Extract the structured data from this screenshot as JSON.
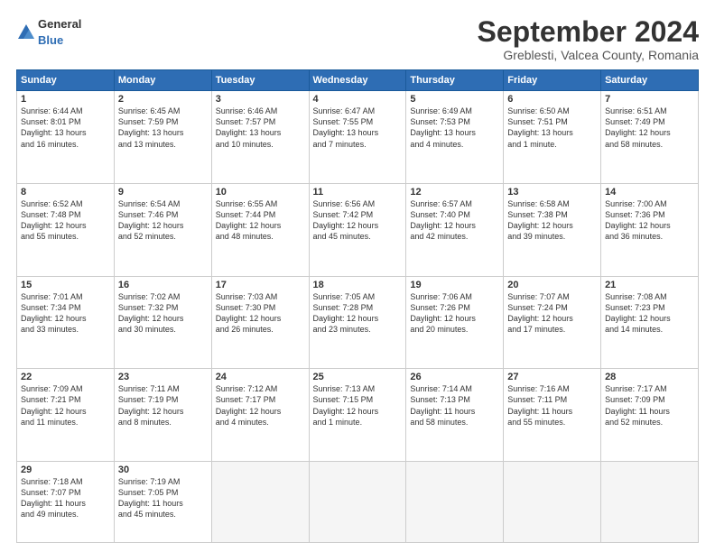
{
  "header": {
    "logo_general": "General",
    "logo_blue": "Blue",
    "month_title": "September 2024",
    "subtitle": "Greblesti, Valcea County, Romania"
  },
  "calendar": {
    "days_of_week": [
      "Sunday",
      "Monday",
      "Tuesday",
      "Wednesday",
      "Thursday",
      "Friday",
      "Saturday"
    ],
    "weeks": [
      [
        null,
        null,
        null,
        null,
        null,
        null,
        null
      ]
    ]
  },
  "days": [
    {
      "num": "1",
      "col": 0,
      "info": "Sunrise: 6:44 AM\nSunset: 8:01 PM\nDaylight: 13 hours\nand 16 minutes."
    },
    {
      "num": "2",
      "col": 1,
      "info": "Sunrise: 6:45 AM\nSunset: 7:59 PM\nDaylight: 13 hours\nand 13 minutes."
    },
    {
      "num": "3",
      "col": 2,
      "info": "Sunrise: 6:46 AM\nSunset: 7:57 PM\nDaylight: 13 hours\nand 10 minutes."
    },
    {
      "num": "4",
      "col": 3,
      "info": "Sunrise: 6:47 AM\nSunset: 7:55 PM\nDaylight: 13 hours\nand 7 minutes."
    },
    {
      "num": "5",
      "col": 4,
      "info": "Sunrise: 6:49 AM\nSunset: 7:53 PM\nDaylight: 13 hours\nand 4 minutes."
    },
    {
      "num": "6",
      "col": 5,
      "info": "Sunrise: 6:50 AM\nSunset: 7:51 PM\nDaylight: 13 hours\nand 1 minute."
    },
    {
      "num": "7",
      "col": 6,
      "info": "Sunrise: 6:51 AM\nSunset: 7:49 PM\nDaylight: 12 hours\nand 58 minutes."
    },
    {
      "num": "8",
      "col": 0,
      "info": "Sunrise: 6:52 AM\nSunset: 7:48 PM\nDaylight: 12 hours\nand 55 minutes."
    },
    {
      "num": "9",
      "col": 1,
      "info": "Sunrise: 6:54 AM\nSunset: 7:46 PM\nDaylight: 12 hours\nand 52 minutes."
    },
    {
      "num": "10",
      "col": 2,
      "info": "Sunrise: 6:55 AM\nSunset: 7:44 PM\nDaylight: 12 hours\nand 48 minutes."
    },
    {
      "num": "11",
      "col": 3,
      "info": "Sunrise: 6:56 AM\nSunset: 7:42 PM\nDaylight: 12 hours\nand 45 minutes."
    },
    {
      "num": "12",
      "col": 4,
      "info": "Sunrise: 6:57 AM\nSunset: 7:40 PM\nDaylight: 12 hours\nand 42 minutes."
    },
    {
      "num": "13",
      "col": 5,
      "info": "Sunrise: 6:58 AM\nSunset: 7:38 PM\nDaylight: 12 hours\nand 39 minutes."
    },
    {
      "num": "14",
      "col": 6,
      "info": "Sunrise: 7:00 AM\nSunset: 7:36 PM\nDaylight: 12 hours\nand 36 minutes."
    },
    {
      "num": "15",
      "col": 0,
      "info": "Sunrise: 7:01 AM\nSunset: 7:34 PM\nDaylight: 12 hours\nand 33 minutes."
    },
    {
      "num": "16",
      "col": 1,
      "info": "Sunrise: 7:02 AM\nSunset: 7:32 PM\nDaylight: 12 hours\nand 30 minutes."
    },
    {
      "num": "17",
      "col": 2,
      "info": "Sunrise: 7:03 AM\nSunset: 7:30 PM\nDaylight: 12 hours\nand 26 minutes."
    },
    {
      "num": "18",
      "col": 3,
      "info": "Sunrise: 7:05 AM\nSunset: 7:28 PM\nDaylight: 12 hours\nand 23 minutes."
    },
    {
      "num": "19",
      "col": 4,
      "info": "Sunrise: 7:06 AM\nSunset: 7:26 PM\nDaylight: 12 hours\nand 20 minutes."
    },
    {
      "num": "20",
      "col": 5,
      "info": "Sunrise: 7:07 AM\nSunset: 7:24 PM\nDaylight: 12 hours\nand 17 minutes."
    },
    {
      "num": "21",
      "col": 6,
      "info": "Sunrise: 7:08 AM\nSunset: 7:23 PM\nDaylight: 12 hours\nand 14 minutes."
    },
    {
      "num": "22",
      "col": 0,
      "info": "Sunrise: 7:09 AM\nSunset: 7:21 PM\nDaylight: 12 hours\nand 11 minutes."
    },
    {
      "num": "23",
      "col": 1,
      "info": "Sunrise: 7:11 AM\nSunset: 7:19 PM\nDaylight: 12 hours\nand 8 minutes."
    },
    {
      "num": "24",
      "col": 2,
      "info": "Sunrise: 7:12 AM\nSunset: 7:17 PM\nDaylight: 12 hours\nand 4 minutes."
    },
    {
      "num": "25",
      "col": 3,
      "info": "Sunrise: 7:13 AM\nSunset: 7:15 PM\nDaylight: 12 hours\nand 1 minute."
    },
    {
      "num": "26",
      "col": 4,
      "info": "Sunrise: 7:14 AM\nSunset: 7:13 PM\nDaylight: 11 hours\nand 58 minutes."
    },
    {
      "num": "27",
      "col": 5,
      "info": "Sunrise: 7:16 AM\nSunset: 7:11 PM\nDaylight: 11 hours\nand 55 minutes."
    },
    {
      "num": "28",
      "col": 6,
      "info": "Sunrise: 7:17 AM\nSunset: 7:09 PM\nDaylight: 11 hours\nand 52 minutes."
    },
    {
      "num": "29",
      "col": 0,
      "info": "Sunrise: 7:18 AM\nSunset: 7:07 PM\nDaylight: 11 hours\nand 49 minutes."
    },
    {
      "num": "30",
      "col": 1,
      "info": "Sunrise: 7:19 AM\nSunset: 7:05 PM\nDaylight: 11 hours\nand 45 minutes."
    }
  ]
}
